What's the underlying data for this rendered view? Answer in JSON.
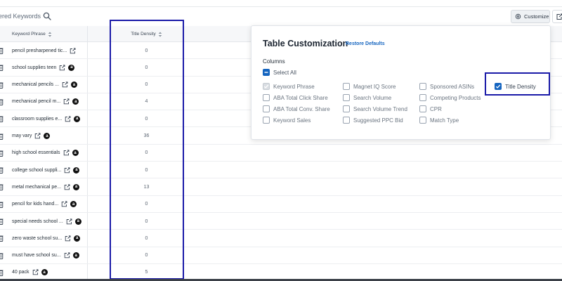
{
  "toolbar": {
    "filtered_label": "ered Keywords",
    "customize_label": "Customize"
  },
  "table": {
    "headers": {
      "keyword": "Keyword Phrase",
      "density": "Title Density"
    },
    "rows": [
      {
        "keyword": "pencil presharpened tic...",
        "amazon": false,
        "density": "0"
      },
      {
        "keyword": "school supplies teen",
        "amazon": true,
        "density": "0"
      },
      {
        "keyword": "mechanical pencils ...",
        "amazon": true,
        "density": "0"
      },
      {
        "keyword": "mechanical pencil m...",
        "amazon": true,
        "density": "4"
      },
      {
        "keyword": "classroom supplies e...",
        "amazon": true,
        "density": "0"
      },
      {
        "keyword": "may vary",
        "amazon": true,
        "density": "36"
      },
      {
        "keyword": "high school essentials",
        "amazon": true,
        "density": "0"
      },
      {
        "keyword": "college school suppli...",
        "amazon": true,
        "density": "0"
      },
      {
        "keyword": "metal mechanical pe...",
        "amazon": true,
        "density": "13"
      },
      {
        "keyword": "pencil for kids hand...",
        "amazon": true,
        "density": "0"
      },
      {
        "keyword": "special needs school ...",
        "amazon": true,
        "density": "0"
      },
      {
        "keyword": "zero waste school su...",
        "amazon": true,
        "density": "0"
      },
      {
        "keyword": "must have school su...",
        "amazon": true,
        "density": "0"
      },
      {
        "keyword": "40 pack",
        "amazon": true,
        "density": "5"
      }
    ]
  },
  "panel": {
    "title": "Table Customization",
    "restore_label": "Restore Defaults",
    "columns_label": "Columns",
    "select_all_label": "Select All",
    "options": [
      {
        "label": "Keyword Phrase",
        "state": "disabled-checked"
      },
      {
        "label": "Magnet IQ Score",
        "state": "unchecked"
      },
      {
        "label": "Sponsored ASINs",
        "state": "unchecked"
      },
      {
        "label": "Title Density",
        "state": "checked"
      },
      {
        "label": "ABA Total Click Share",
        "state": "unchecked"
      },
      {
        "label": "Search Volume",
        "state": "unchecked"
      },
      {
        "label": "Competing Products",
        "state": "unchecked"
      },
      {
        "label": "ABA Total Conv. Share",
        "state": "unchecked"
      },
      {
        "label": "Search Volume Trend",
        "state": "unchecked"
      },
      {
        "label": "CPR",
        "state": "unchecked"
      },
      {
        "label": "Keyword Sales",
        "state": "unchecked"
      },
      {
        "label": "Suggested PPC Bid",
        "state": "unchecked"
      },
      {
        "label": "Match Type",
        "state": "unchecked"
      }
    ]
  },
  "colors": {
    "accent": "#1565c0",
    "highlight": "#1a1aa8"
  },
  "icons": {
    "search": "search-icon",
    "customize": "gear-icon",
    "export": "export-icon",
    "delete": "trash-icon",
    "external": "external-link-icon",
    "amazon": "amazon-icon"
  }
}
